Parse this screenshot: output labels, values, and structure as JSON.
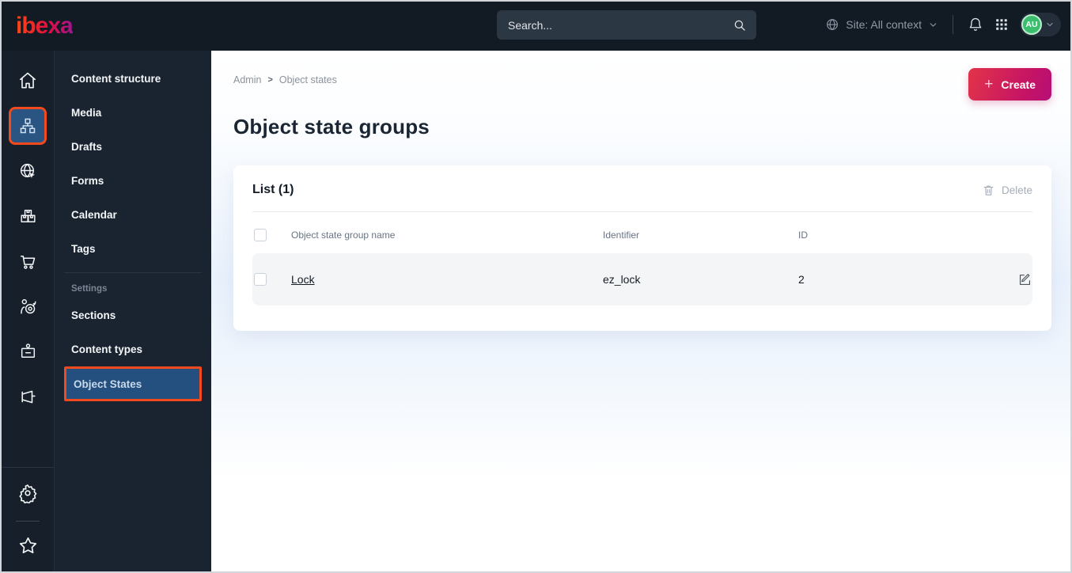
{
  "topbar": {
    "logo_text": "ibexa",
    "search_placeholder": "Search...",
    "site_context_label": "Site: All context",
    "avatar_initials": "AU"
  },
  "icon_rail": {
    "items": [
      {
        "icon": "home-icon",
        "active": false
      },
      {
        "icon": "content-structure-icon",
        "active": true
      },
      {
        "icon": "site-globe-icon",
        "active": false
      },
      {
        "icon": "products-boxes-icon",
        "active": false
      },
      {
        "icon": "cart-icon",
        "active": false
      },
      {
        "icon": "customers-target-icon",
        "active": false
      },
      {
        "icon": "corporate-badge-icon",
        "active": false
      },
      {
        "icon": "marketing-megaphone-icon",
        "active": false
      },
      {
        "icon": "settings-gear-icon",
        "active": false
      },
      {
        "icon": "bookmarks-star-icon",
        "active": false
      }
    ]
  },
  "sidebar": {
    "items": [
      "Content structure",
      "Media",
      "Drafts",
      "Forms",
      "Calendar",
      "Tags"
    ],
    "settings_label": "Settings",
    "settings_items": [
      "Sections",
      "Content types",
      "Object States"
    ],
    "active_item": "Object States"
  },
  "main": {
    "breadcrumb": [
      "Admin",
      "Object states"
    ],
    "breadcrumb_separator": ">",
    "create_label": "Create",
    "page_title": "Object state groups",
    "panel": {
      "title": "List (1)",
      "delete_label": "Delete",
      "columns": [
        "Object state group name",
        "Identifier",
        "ID"
      ],
      "rows": [
        {
          "name": "Lock",
          "identifier": "ez_lock",
          "id": "2"
        }
      ]
    }
  },
  "colors": {
    "topbar_bg": "#121a24",
    "sidebar_bg": "#1a2431",
    "active_highlight_blue": "#23507f",
    "annotation_orange": "#f2491d",
    "brand_gradient": [
      "#ff4713",
      "#e2103e",
      "#a0148e"
    ],
    "create_gradient": [
      "#e23449",
      "#b50f77"
    ],
    "avatar_green": "#3bbf6e",
    "row_bg": "#f4f5f7",
    "page_gradient_blue": "#e9f1fc"
  }
}
